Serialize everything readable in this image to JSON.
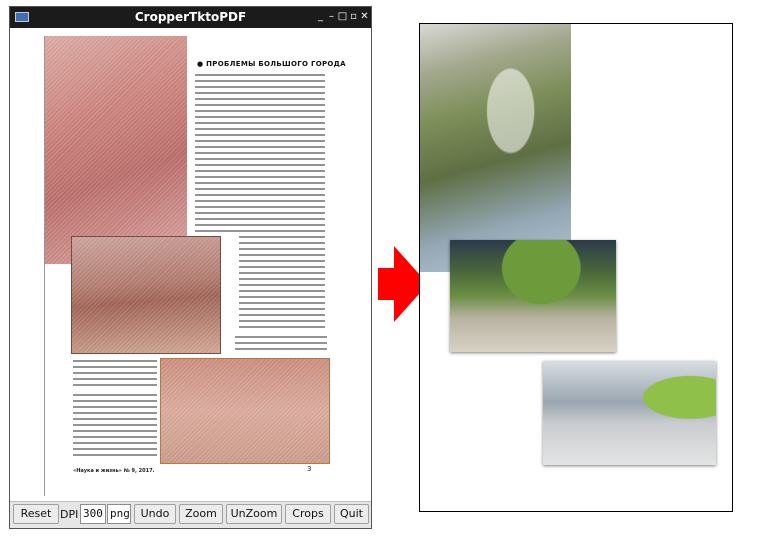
{
  "window": {
    "title": "CropperTktoPDF",
    "controls": [
      "_",
      "–",
      "□",
      "▫",
      "✕"
    ]
  },
  "page": {
    "headline": "● ПРОБЛЕМЫ БОЛЬШОГО ГОРОДА",
    "footer": "«Наука и жизнь» № 9, 2017.",
    "page_number": "3"
  },
  "toolbar": {
    "reset": "Reset",
    "dpi_label": "DPI",
    "dpi_value": "300",
    "format_value": "png",
    "undo": "Undo",
    "zoom": "Zoom",
    "unzoom": "UnZoom",
    "crops": "Crops",
    "quit": "Quit"
  },
  "colors": {
    "titlebar": "#1b1b1b",
    "crop_highlight": "#c97f7a",
    "arrow": "#ff0000"
  }
}
